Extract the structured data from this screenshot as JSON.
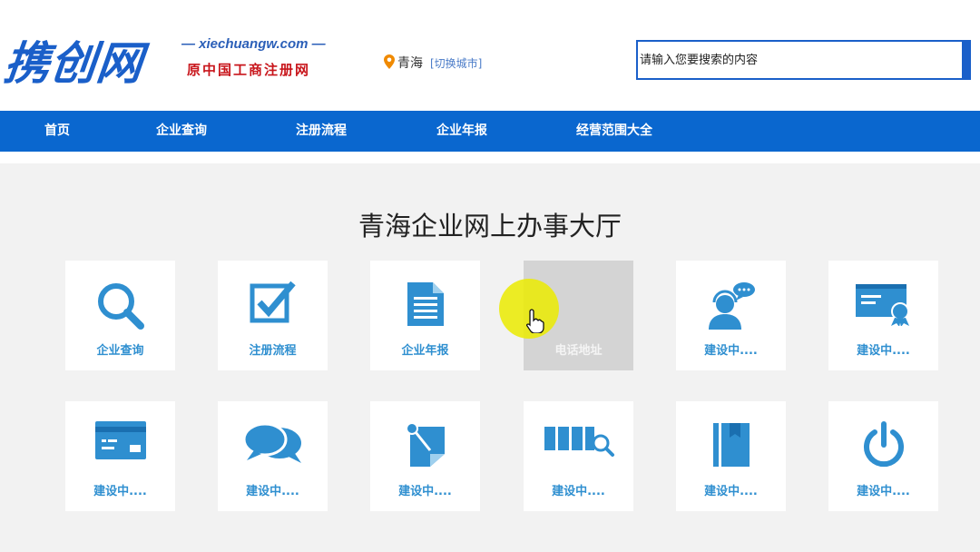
{
  "header": {
    "logo_text": "携创网",
    "domain": "— xiechuangw.com —",
    "subtitle": "原中国工商注册网",
    "city": "青海",
    "switch_city": "[切换城市]",
    "search_placeholder": "请输入您要搜索的内容"
  },
  "nav": {
    "items": [
      "首页",
      "企业查询",
      "注册流程",
      "企业年报",
      "经营范围大全"
    ]
  },
  "hall": {
    "title": "青海企业网上办事大厅",
    "cards": [
      {
        "label": "企业查询",
        "icon": "magnifier-icon"
      },
      {
        "label": "注册流程",
        "icon": "checkbox-icon"
      },
      {
        "label": "企业年报",
        "icon": "document-icon"
      },
      {
        "label": "电话地址",
        "icon": "phone-address-icon"
      },
      {
        "label": "建设中....",
        "icon": "customer-service-icon"
      },
      {
        "label": "建设中....",
        "icon": "certificate-icon"
      },
      {
        "label": "建设中....",
        "icon": "card-icon"
      },
      {
        "label": "建设中....",
        "icon": "chat-bubbles-icon"
      },
      {
        "label": "建设中....",
        "icon": "pin-note-icon"
      },
      {
        "label": "建设中....",
        "icon": "bar-search-icon"
      },
      {
        "label": "建设中....",
        "icon": "book-icon"
      },
      {
        "label": "建设中....",
        "icon": "power-icon"
      }
    ]
  },
  "colors": {
    "brand_blue": "#0a67cf",
    "icon_blue": "#2f8fd0",
    "logo_red": "#c8151b"
  }
}
